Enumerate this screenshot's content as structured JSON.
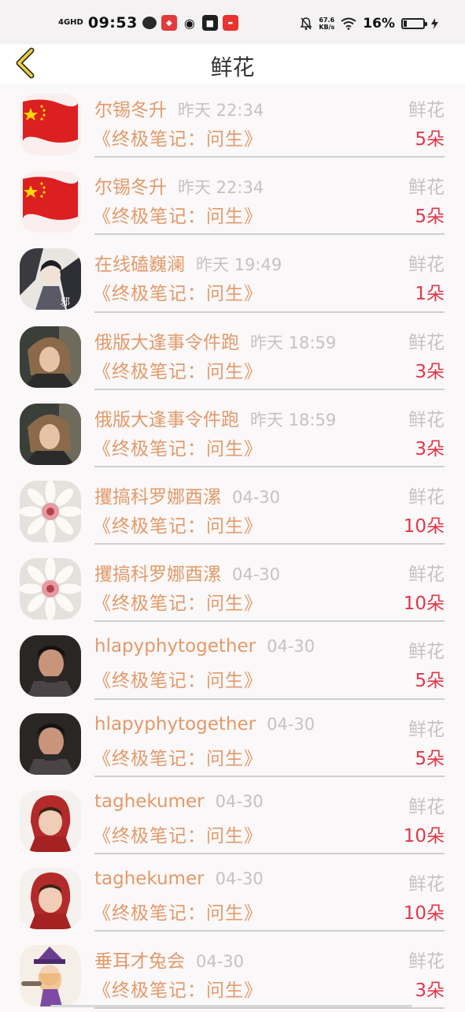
{
  "status_bar": {
    "network": "4GHD",
    "time": "09:53",
    "net_speed_value": "67.6",
    "net_speed_unit": "KB/s",
    "battery": "16%",
    "battery_level": 0.16
  },
  "header": {
    "title": "鲜花"
  },
  "items": [
    {
      "name": "尔锡冬升",
      "time": "昨天 22:34",
      "book": "《终极笔记：问生》",
      "type": "鲜花",
      "count": "5朵",
      "avatar": "flag-icon"
    },
    {
      "name": "尔锡冬升",
      "time": "昨天 22:34",
      "book": "《终极笔记：问生》",
      "type": "鲜花",
      "count": "5朵",
      "avatar": "flag-icon"
    },
    {
      "name": "在线磕巍澜",
      "time": "昨天 19:49",
      "book": "《终极笔记：问生》",
      "type": "鲜花",
      "count": "1朵",
      "avatar": "illustration-avatar"
    },
    {
      "name": "俄版大逢事令件跑",
      "time": "昨天 18:59",
      "book": "《终极笔记：问生》",
      "type": "鲜花",
      "count": "3朵",
      "avatar": "portrait-avatar"
    },
    {
      "name": "俄版大逢事令件跑",
      "time": "昨天 18:59",
      "book": "《终极笔记：问生》",
      "type": "鲜花",
      "count": "3朵",
      "avatar": "portrait-avatar"
    },
    {
      "name": "攫搞科罗娜酉漯",
      "time": "04-30",
      "book": "《终极笔记：问生》",
      "type": "鲜花",
      "count": "10朵",
      "avatar": "flower-avatar"
    },
    {
      "name": "攫搞科罗娜酉漯",
      "time": "04-30",
      "book": "《终极笔记：问生》",
      "type": "鲜花",
      "count": "10朵",
      "avatar": "flower-avatar"
    },
    {
      "name": "hlapyphytogether",
      "time": "04-30",
      "book": "《终极笔记：问生》",
      "type": "鲜花",
      "count": "5朵",
      "avatar": "man-avatar"
    },
    {
      "name": "hlapyphytogether",
      "time": "04-30",
      "book": "《终极笔记：问生》",
      "type": "鲜花",
      "count": "5朵",
      "avatar": "man-avatar"
    },
    {
      "name": "taghekumer",
      "time": "04-30",
      "book": "《终极笔记：问生》",
      "type": "鲜花",
      "count": "10朵",
      "avatar": "child-avatar"
    },
    {
      "name": "taghekumer",
      "time": "04-30",
      "book": "《终极笔记：问生》",
      "type": "鲜花",
      "count": "10朵",
      "avatar": "child-avatar"
    },
    {
      "name": "垂耳才兔会",
      "time": "04-30",
      "book": "《终极笔记：问生》",
      "type": "鲜花",
      "count": "3朵",
      "avatar": "cartoon-avatar"
    }
  ]
}
